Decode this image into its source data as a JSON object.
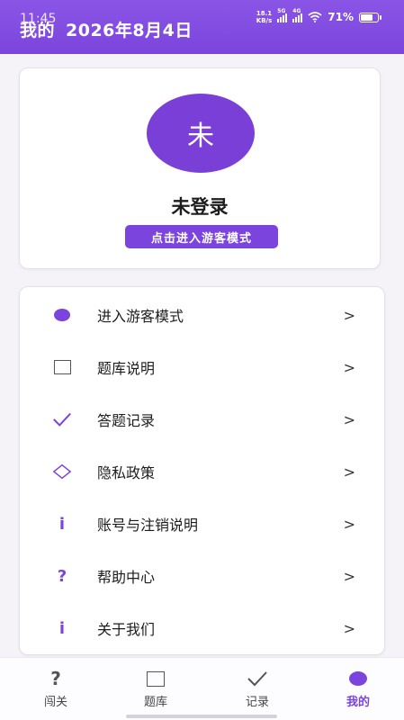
{
  "status_bar": {
    "time": "11:45",
    "net_speed_value": "18.1",
    "net_speed_unit": "KB/s",
    "signal1_label": "5G",
    "signal2_label": "4G",
    "battery_percent": "71%",
    "battery_level": 0.71
  },
  "header": {
    "title": "我的",
    "date": "2026年8月4日",
    "background_color": "#7b45dd"
  },
  "profile": {
    "avatar_text": "未",
    "status_text": "未登录",
    "guest_button_label": "点击进入游客模式"
  },
  "menu": {
    "items": [
      {
        "label": "进入游客模式",
        "icon": "filled-circle-icon",
        "arrow": ">"
      },
      {
        "label": "题库说明",
        "icon": "square-icon",
        "arrow": ">"
      },
      {
        "label": "答题记录",
        "icon": "check-icon",
        "arrow": ">"
      },
      {
        "label": "隐私政策",
        "icon": "diamond-icon",
        "arrow": ">"
      },
      {
        "label": "账号与注销说明",
        "icon": "info-icon",
        "icon_text": "i",
        "arrow": ">"
      },
      {
        "label": "帮助中心",
        "icon": "question-icon",
        "icon_text": "?",
        "arrow": ">"
      },
      {
        "label": "关于我们",
        "icon": "info-icon",
        "icon_text": "i",
        "arrow": ">"
      }
    ]
  },
  "bottom_nav": {
    "items": [
      {
        "label": "闯关",
        "icon": "question-icon",
        "icon_text": "?"
      },
      {
        "label": "题库",
        "icon": "square-icon"
      },
      {
        "label": "记录",
        "icon": "check-icon"
      },
      {
        "label": "我的",
        "icon": "filled-circle-icon",
        "active": true
      }
    ]
  },
  "colors": {
    "accent": "#7b45dd",
    "page_background": "#f5f3f8"
  }
}
